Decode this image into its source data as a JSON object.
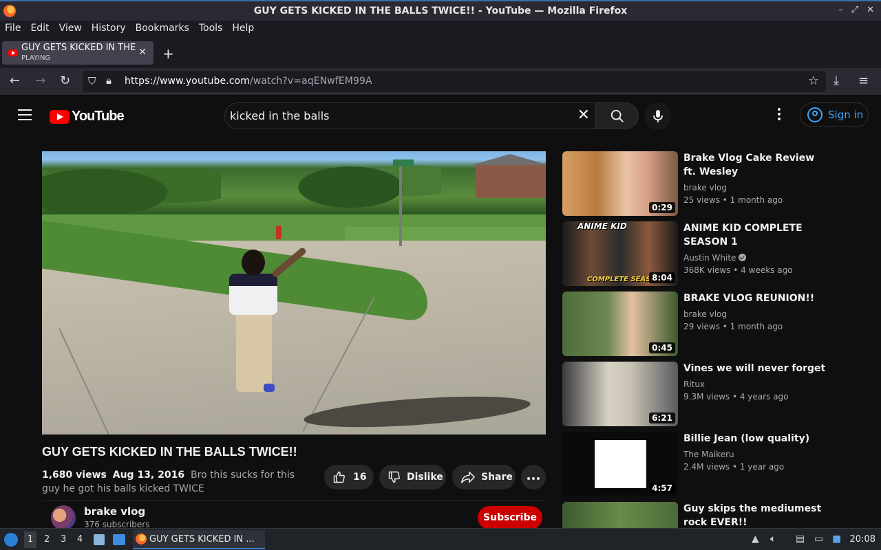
{
  "window": {
    "title": "GUY GETS KICKED IN THE BALLS TWICE!! - YouTube — Mozilla Firefox",
    "controls": [
      "–",
      "⤢",
      "✕"
    ]
  },
  "menu": [
    "File",
    "Edit",
    "View",
    "History",
    "Bookmarks",
    "Tools",
    "Help"
  ],
  "tab": {
    "title": "GUY GETS KICKED IN THE",
    "subtitle": "PLAYING",
    "close": "✕",
    "new_tab": "+"
  },
  "nav": {
    "url_host": "https://www.youtube.com",
    "url_path": "/watch?v=aqENwfEM99A"
  },
  "youtube": {
    "logo_text": "YouTube",
    "search_query": "kicked in the balls",
    "sign_in": "Sign in"
  },
  "video": {
    "title": "GUY GETS KICKED IN THE BALLS TWICE!!",
    "views": "1,680 views",
    "date": "Aug 13, 2016",
    "description": "Bro this sucks for this guy he got his balls kicked TWICE",
    "likes": "16",
    "dislike_label": "Dislike",
    "share_label": "Share",
    "channel": "brake vlog",
    "subscribers": "376 subscribers",
    "subscribe_label": "Subscribe"
  },
  "related": [
    {
      "title": "Brake Vlog Cake Review ft. Wesley",
      "channel": "brake vlog",
      "stats": "25 views • 1 month ago",
      "duration": "0:29",
      "verified": false
    },
    {
      "title": "ANIME KID COMPLETE SEASON 1",
      "channel": "Austin White",
      "stats": "368K views • 4 weeks ago",
      "duration": "8:04",
      "verified": true,
      "thumb_text_top": "ANIME KID",
      "thumb_text_bottom": "COMPLETE SEASO"
    },
    {
      "title": "BRAKE VLOG REUNION!!",
      "channel": "brake vlog",
      "stats": "29 views • 1 month ago",
      "duration": "0:45",
      "verified": false
    },
    {
      "title": "Vines we will never forget",
      "channel": "Ritux",
      "stats": "9.3M views • 4 years ago",
      "duration": "6:21",
      "verified": false
    },
    {
      "title": "Billie Jean (low quality)",
      "channel": "The Maikeru",
      "stats": "2.4M views • 1 year ago",
      "duration": "4:57",
      "verified": false
    },
    {
      "title": "Guy skips the mediumest rock EVER!!",
      "channel": "",
      "stats": "",
      "duration": "",
      "verified": false
    }
  ],
  "taskbar": {
    "workspaces": [
      "1",
      "2",
      "3",
      "4"
    ],
    "task_title": "GUY GETS KICKED IN ...",
    "clock": "20:08"
  }
}
